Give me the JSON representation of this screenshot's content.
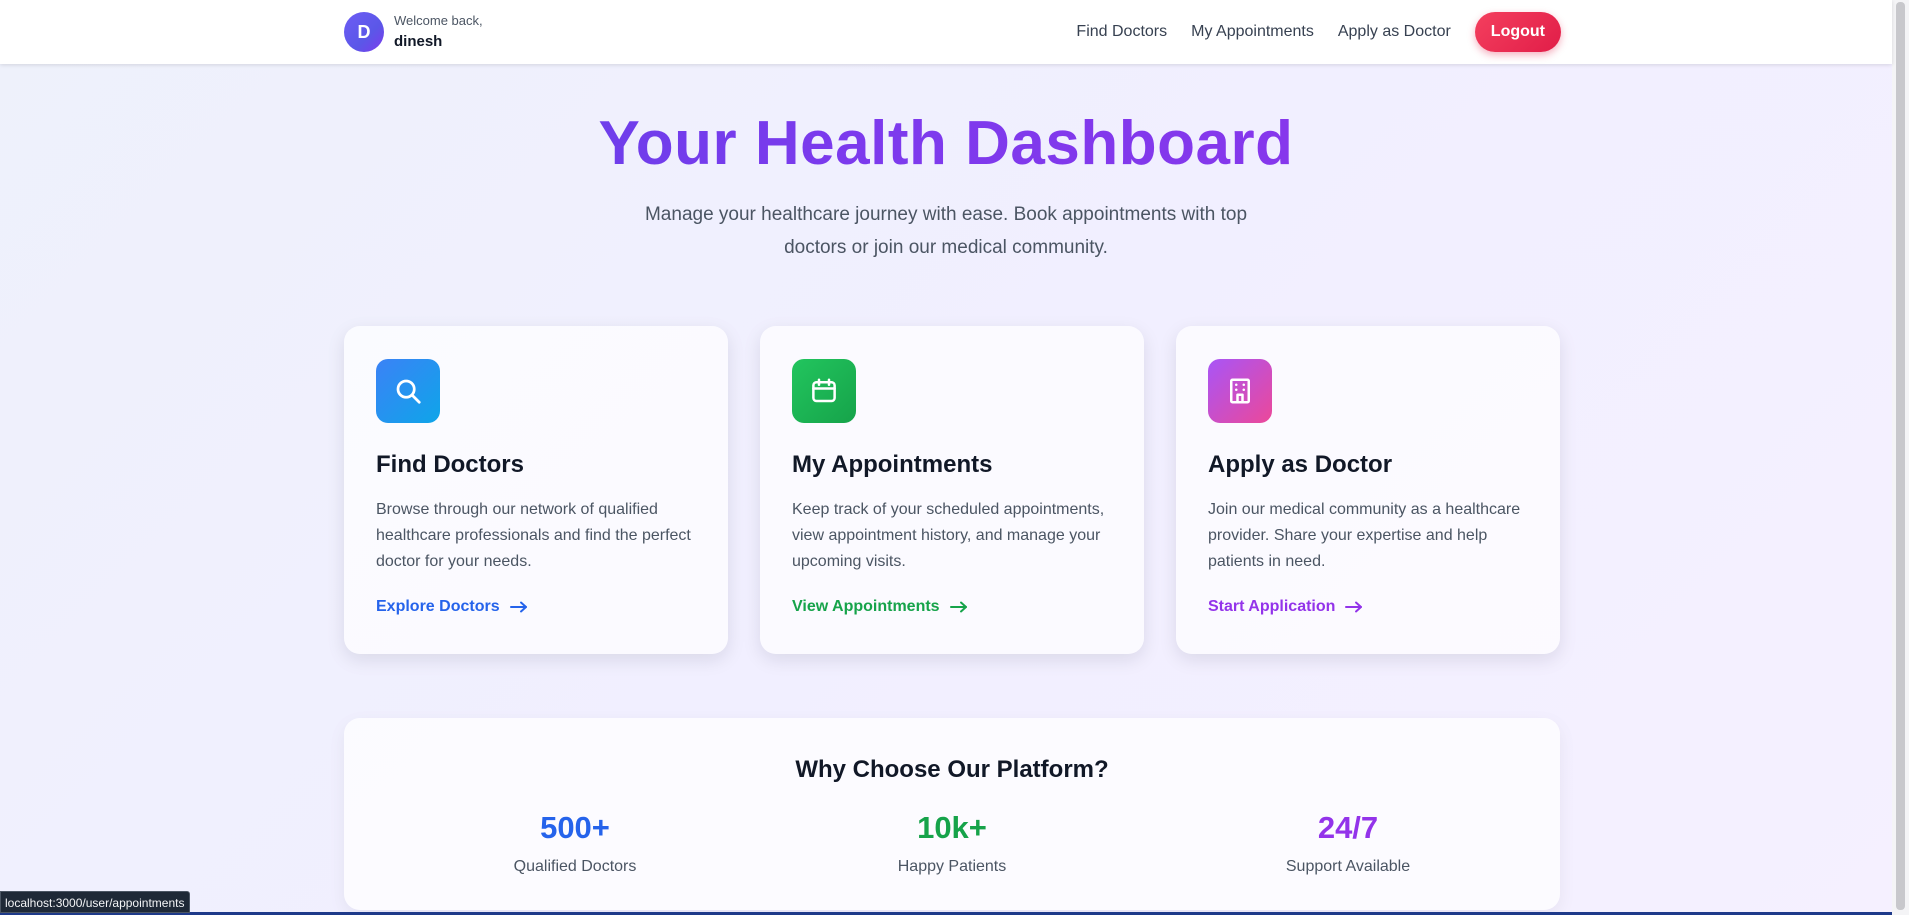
{
  "header": {
    "avatar_letter": "D",
    "welcome_text": "Welcome back,",
    "username": "dinesh",
    "nav": [
      "Find Doctors",
      "My Appointments",
      "Apply as Doctor"
    ],
    "logout_label": "Logout"
  },
  "hero": {
    "title": "Your Health Dashboard",
    "subtitle": "Manage your healthcare journey with ease. Book appointments with top doctors or join our medical community."
  },
  "cards": [
    {
      "icon": "search-icon",
      "title": "Find Doctors",
      "description": "Browse through our network of qualified healthcare professionals and find the perfect doctor for your needs.",
      "link_label": "Explore Doctors",
      "accent": "#2563eb"
    },
    {
      "icon": "calendar-icon",
      "title": "My Appointments",
      "description": "Keep track of your scheduled appointments, view appointment history, and manage your upcoming visits.",
      "link_label": "View Appointments",
      "accent": "#16a34a"
    },
    {
      "icon": "building-icon",
      "title": "Apply as Doctor",
      "description": "Join our medical community as a healthcare provider. Share your expertise and help patients in need.",
      "link_label": "Start Application",
      "accent": "#9333ea"
    }
  ],
  "stats": {
    "title": "Why Choose Our Platform?",
    "items": [
      {
        "value": "500+",
        "label": "Qualified Doctors",
        "color": "#2563eb"
      },
      {
        "value": "10k+",
        "label": "Happy Patients",
        "color": "#16a34a"
      },
      {
        "value": "24/7",
        "label": "Support Available",
        "color": "#9333ea"
      }
    ]
  },
  "status_bar": {
    "url": "localhost:3000/user/appointments"
  }
}
